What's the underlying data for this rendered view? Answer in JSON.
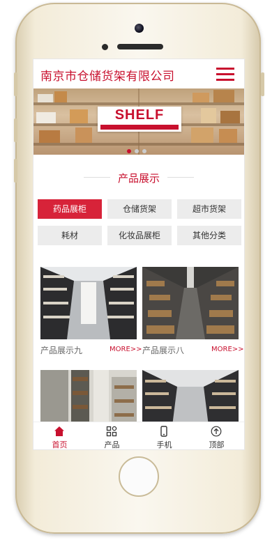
{
  "header": {
    "title": "南京市仓储货架有限公司"
  },
  "banner": {
    "word": "SHELF",
    "slides": 3
  },
  "section": {
    "title": "产品展示"
  },
  "categories": [
    {
      "label": "药品展柜",
      "active": true
    },
    {
      "label": "仓储货架",
      "active": false
    },
    {
      "label": "超市货架",
      "active": false
    },
    {
      "label": "耗材",
      "active": false
    },
    {
      "label": "化妆品展柜",
      "active": false
    },
    {
      "label": "其他分类",
      "active": false
    }
  ],
  "products": [
    {
      "name": "产品展示九",
      "more": "MORE>>"
    },
    {
      "name": "产品展示八",
      "more": "MORE>>"
    },
    {
      "name": "",
      "more": ""
    },
    {
      "name": "",
      "more": ""
    }
  ],
  "tabbar": [
    {
      "label": "首页",
      "icon": "home-icon",
      "active": true
    },
    {
      "label": "产品",
      "icon": "grid-icon",
      "active": false
    },
    {
      "label": "手机",
      "icon": "phone-icon",
      "active": false
    },
    {
      "label": "顶部",
      "icon": "arrow-up-icon",
      "active": false
    }
  ],
  "colors": {
    "brand": "#c8102e",
    "active_tab_bg": "#d72339"
  }
}
